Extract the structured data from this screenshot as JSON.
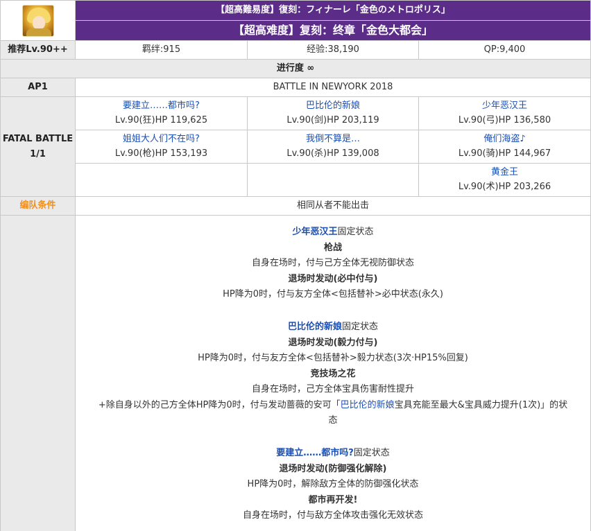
{
  "quest": {
    "title_jp": "【超高難易度】復刻：フィナーレ「金色のメトロポリス」",
    "title_cn": "【超高难度】复刻：终章「金色大都会」",
    "portrait_icon": "gilgamesh-portrait-icon",
    "recommend_level": "推荐Lv.90++",
    "bond": "羁绊:915",
    "exp": "经验:38,190",
    "qp": "QP:9,400",
    "progress_label": "进行度 ∞",
    "ap_label": "AP1",
    "battle_name": "BATTLE IN NEWYORK 2018",
    "fatal_label": "FATAL BATTLE",
    "fatal_count": "1/1",
    "formation_label": "编队条件",
    "formation_value": "相同从者不能出击",
    "colors": {
      "header_purple": "#5b2d89",
      "label_gray": "#eaeaea",
      "link_blue": "#1a4fb4",
      "orange": "#f0901e",
      "border": "#c8c8c8"
    }
  },
  "enemies": [
    {
      "name": "要建立……都市吗?",
      "stats": "Lv.90(狂)HP 119,625"
    },
    {
      "name": "巴比伦的新娘",
      "stats": "Lv.90(剑)HP 203,119"
    },
    {
      "name": "少年恶汉王",
      "stats": "Lv.90(弓)HP 136,580"
    },
    {
      "name": "姐姐大人们不在吗?",
      "stats": "Lv.90(枪)HP 153,193"
    },
    {
      "name": "我倒不算是…",
      "stats": "Lv.90(杀)HP 139,008"
    },
    {
      "name": "俺们海盗♪",
      "stats": "Lv.90(骑)HP 144,967"
    },
    {
      "name": "黄金王",
      "stats": "Lv.90(术)HP 203,266"
    }
  ],
  "skills": {
    "s1": {
      "name": "少年恶汉王",
      "suffix": "固定状态"
    },
    "s1_l2": "枪战",
    "s1_l3": "自身在场时，付与己方全体无视防御状态",
    "s1_l4": "退场时发动(必中付与)",
    "s1_l5": "HP降为0时，付与友方全体<包括替补>必中状态(永久)",
    "s2": {
      "name": "巴比伦的新娘",
      "suffix": "固定状态"
    },
    "s2_l2": "退场时发动(毅力付与)",
    "s2_l3": "HP降为0时，付与友方全体<包括替补>毅力状态(3次·HP15%回复)",
    "s2_l4": "竞技场之花",
    "s2_l5": "自身在场时，己方全体宝具伤害耐性提升",
    "s2_l6a": "+除自身以外的己方全体HP降为0时，付与发动蔷薇的安可「",
    "s2_l6b": "巴比伦的新娘",
    "s2_l6c": "宝具充能至最大&宝具威力提升(1次)」的状",
    "s2_l7": "态",
    "s3": {
      "name": "要建立……都市吗?",
      "suffix": "固定状态"
    },
    "s3_l2": "退场时发动(防御强化解除)",
    "s3_l3": "HP降为0时，解除敌方全体的防御强化状态",
    "s3_l4": "都市再开发!",
    "s3_l5": "自身在场时，付与敌方全体攻击强化无效状态"
  }
}
